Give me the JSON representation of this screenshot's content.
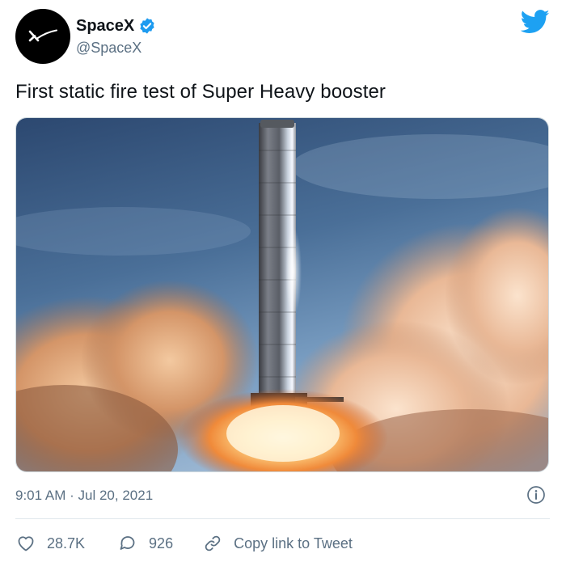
{
  "author": {
    "name": "SpaceX",
    "handle": "@SpaceX"
  },
  "tweet": {
    "text": "First static fire test of Super Heavy booster",
    "time": "9:01 AM",
    "separator": "·",
    "date": "Jul 20, 2021"
  },
  "actions": {
    "likes": "28.7K",
    "replies": "926",
    "copy_link": "Copy link to Tweet"
  },
  "icons": {
    "brand": "twitter-bird-icon",
    "verified": "verified-badge-icon",
    "info": "info-icon",
    "like": "heart-icon",
    "reply": "reply-bubble-icon",
    "link": "link-icon"
  },
  "colors": {
    "twitter_blue": "#1da1f2",
    "verified_blue": "#1d9bf0",
    "secondary_text": "#5b7083",
    "primary_text": "#0f1419"
  }
}
